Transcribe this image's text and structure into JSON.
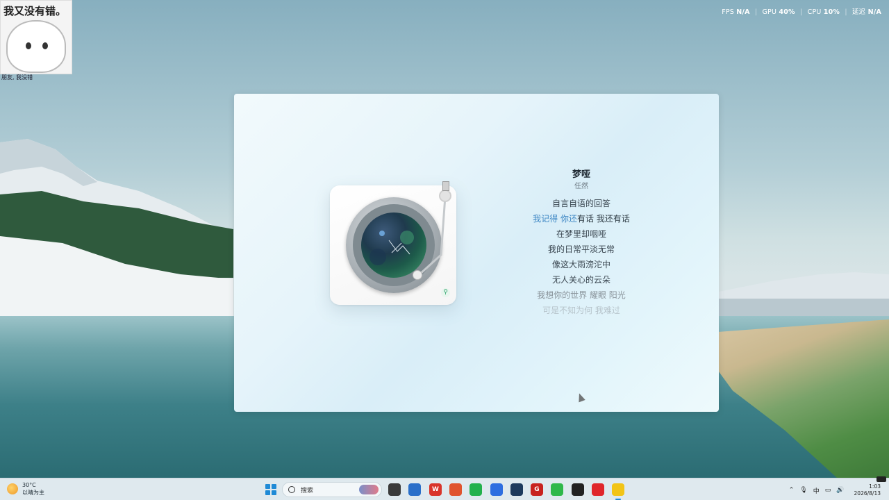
{
  "desktop": {
    "sticker": {
      "title": "我又没有错。",
      "caption": "朋友, 我没错"
    },
    "perf": {
      "fps_label": "FPS",
      "fps_value": "N/A",
      "gpu_label": "GPU",
      "gpu_value": "40%",
      "cpu_label": "CPU",
      "cpu_value": "10%",
      "latency_label": "延迟",
      "latency_value": "N/A"
    }
  },
  "player": {
    "song_title": "梦哑",
    "artist": "任然",
    "lyrics": [
      {
        "text": "自言自语的回答",
        "state": "normal"
      },
      {
        "highlight": "我记得 你还",
        "rest": "有话 我还有话",
        "state": "active"
      },
      {
        "text": "在梦里却咽哑",
        "state": "normal"
      },
      {
        "text": "我的日常平淡无常",
        "state": "normal"
      },
      {
        "text": "像这大雨滂沱中",
        "state": "normal"
      },
      {
        "text": "无人关心的云朵",
        "state": "normal"
      },
      {
        "text": "我想你的世界 耀眼 阳光",
        "state": "dim1"
      },
      {
        "text": "可是不知为何 我难过",
        "state": "dim2"
      }
    ]
  },
  "taskbar": {
    "weather": {
      "temp": "30°C",
      "desc": "以晴为主"
    },
    "search_label": "搜索",
    "apps": [
      {
        "name": "file-explorer",
        "color": "#3a3a3a",
        "glyph": ""
      },
      {
        "name": "store",
        "color": "#2a6fc9",
        "glyph": ""
      },
      {
        "name": "wps",
        "color": "#d9352b",
        "glyph": "W"
      },
      {
        "name": "app-red-fox",
        "color": "#e0542e",
        "glyph": ""
      },
      {
        "name": "wechat",
        "color": "#22b14c",
        "glyph": ""
      },
      {
        "name": "app-blue-circle",
        "color": "#2d6ee0",
        "glyph": ""
      },
      {
        "name": "app-dev",
        "color": "#1e3a5c",
        "glyph": ""
      },
      {
        "name": "app-red-g",
        "color": "#c8231f",
        "glyph": "G"
      },
      {
        "name": "app-green-bar",
        "color": "#2fb84a",
        "glyph": ""
      },
      {
        "name": "app-black-swirl",
        "color": "#222222",
        "glyph": ""
      },
      {
        "name": "netease-music",
        "color": "#e0262b",
        "glyph": ""
      },
      {
        "name": "music-player",
        "color": "#f2c416",
        "glyph": "",
        "active": true
      }
    ],
    "tray": {
      "ime": "中",
      "time": "1:03",
      "date": "2026/8/13"
    }
  }
}
